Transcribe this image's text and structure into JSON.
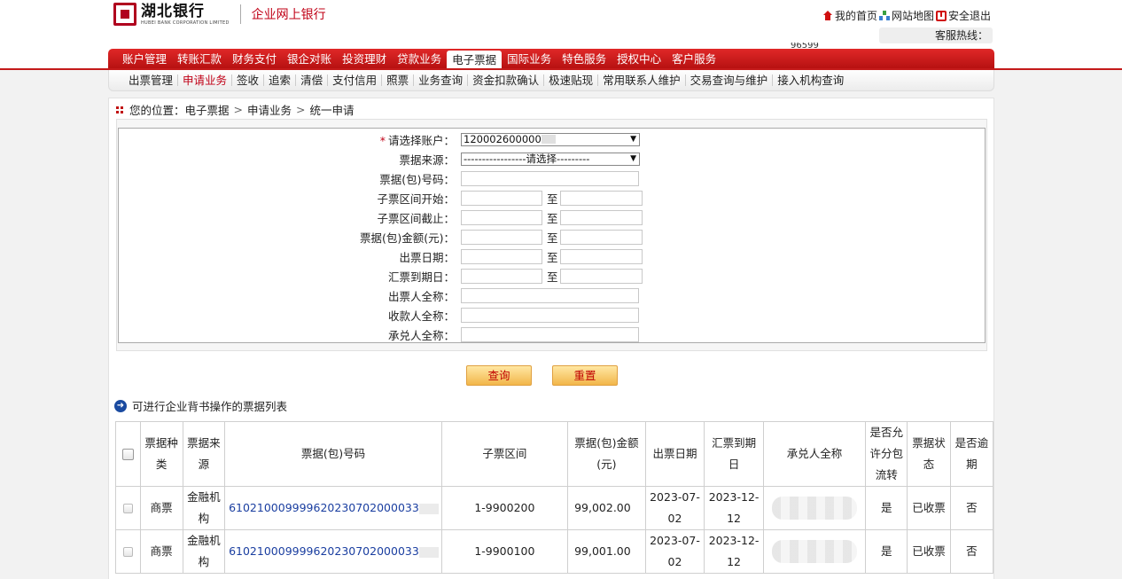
{
  "header": {
    "logo_cn": "湖北银行",
    "logo_en": "HUBEI BANK CORPORATION LIMITED",
    "logo_sub": "企业网上银行",
    "links": [
      {
        "label": "我的首页",
        "icon": "home-icon"
      },
      {
        "label": "网站地图",
        "icon": "sitemap-icon"
      },
      {
        "label": "安全退出",
        "icon": "logout-icon"
      }
    ],
    "hotline_label": "客服热线：",
    "peek_text": "96599"
  },
  "main_nav": [
    "账户管理",
    "转账汇款",
    "财务支付",
    "银企对账",
    "投资理财",
    "贷款业务",
    "电子票据",
    "国际业务",
    "特色服务",
    "授权中心",
    "客户服务"
  ],
  "main_nav_active": "电子票据",
  "sub_nav": [
    "出票管理",
    "申请业务",
    "签收",
    "追索",
    "清偿",
    "支付信用",
    "照票",
    "业务查询",
    "资金扣款确认",
    "极速贴现",
    "常用联系人维护",
    "交易查询与维护",
    "接入机构查询"
  ],
  "sub_nav_active": "申请业务",
  "breadcrumb": {
    "prefix": "您的位置：",
    "items": [
      "电子票据",
      "申请业务",
      "统一申请"
    ],
    "separator": ">"
  },
  "form": {
    "account_label": "请选择账户：",
    "account_value": "120002600000",
    "source_label": "票据来源：",
    "source_value": "-----------------请选择---------",
    "bill_no_label": "票据(包)号码：",
    "sub_start_label": "子票区间开始：",
    "sub_end_label": "子票区间截止：",
    "amount_label": "票据(包)金额(元)：",
    "issue_date_label": "出票日期：",
    "due_date_label": "汇票到期日：",
    "drawer_label": "出票人全称：",
    "payee_label": "收款人全称：",
    "acceptor_label": "承兑人全称：",
    "to": "至"
  },
  "buttons": {
    "query": "查询",
    "reset": "重置"
  },
  "list_title": "可进行企业背书操作的票据列表",
  "table": {
    "headers": [
      "票据种类",
      "票据来源",
      "票据(包)号码",
      "子票区间",
      "票据(包)金额(元)",
      "出票日期",
      "汇票到期日",
      "承兑人全称",
      "是否允许分包流转",
      "票据状态",
      "是否逾期"
    ],
    "rows": [
      {
        "type": "商票",
        "source": "金融机构",
        "bill_no": "610210009999620230702000033",
        "range": "1-9900200",
        "amount": "99,002.00",
        "issue": "2023-07-02",
        "due": "2023-12-12",
        "split": "是",
        "status": "已收票",
        "overdue": "否"
      },
      {
        "type": "商票",
        "source": "金融机构",
        "bill_no": "610210009999620230702000033",
        "range": "1-9900100",
        "amount": "99,001.00",
        "issue": "2023-07-02",
        "due": "2023-12-12",
        "split": "是",
        "status": "已收票",
        "overdue": "否"
      }
    ]
  },
  "colors": {
    "brand_red": "#c00016",
    "nav_red": "#d42020",
    "button_gold": "#f2b64a",
    "link_blue": "#1a3ea0"
  }
}
